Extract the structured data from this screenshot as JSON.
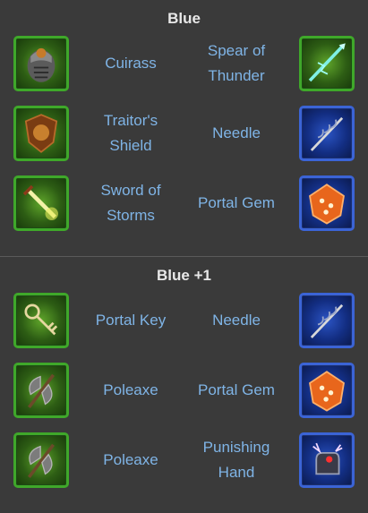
{
  "sections": [
    {
      "title": "Blue",
      "rows": [
        {
          "left": {
            "name": "Cuirass",
            "icon": "cuirass-icon",
            "rarity": "green"
          },
          "right": {
            "name": "Spear of\nThunder",
            "icon": "spear-of-thunder-icon",
            "rarity": "green"
          }
        },
        {
          "left": {
            "name": "Traitor's\nShield",
            "icon": "traitors-shield-icon",
            "rarity": "green"
          },
          "right": {
            "name": "Needle",
            "icon": "needle-icon",
            "rarity": "blue"
          }
        },
        {
          "left": {
            "name": "Sword of\nStorms",
            "icon": "sword-of-storms-icon",
            "rarity": "green"
          },
          "right": {
            "name": "Portal Gem",
            "icon": "portal-gem-icon",
            "rarity": "blue"
          }
        }
      ]
    },
    {
      "title": "Blue +1",
      "rows": [
        {
          "left": {
            "name": "Portal Key",
            "icon": "portal-key-icon",
            "rarity": "green"
          },
          "right": {
            "name": "Needle",
            "icon": "needle-icon",
            "rarity": "blue"
          }
        },
        {
          "left": {
            "name": "Poleaxe",
            "icon": "poleaxe-icon",
            "rarity": "green"
          },
          "right": {
            "name": "Portal Gem",
            "icon": "portal-gem-icon",
            "rarity": "blue"
          }
        },
        {
          "left": {
            "name": "Poleaxe",
            "icon": "poleaxe-icon",
            "rarity": "green"
          },
          "right": {
            "name": "Punishing\nHand",
            "icon": "punishing-hand-icon",
            "rarity": "blue"
          }
        }
      ]
    }
  ],
  "colors": {
    "background": "#3a3a3a",
    "title": "#e8e8e8",
    "item_label": "#7fb4e6",
    "green_frame": "#3fa82a",
    "blue_frame": "#3b64d6"
  }
}
